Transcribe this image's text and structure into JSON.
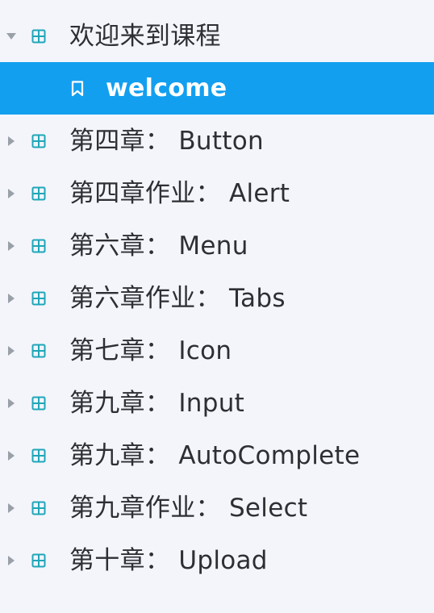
{
  "colors": {
    "background": "#f3f5fb",
    "selected_bg": "#139ff0",
    "icon": "#1fa6b8",
    "arrow": "#9aa0a8",
    "text": "#2d2f35"
  },
  "tree": {
    "root": {
      "label": "欢迎来到课程",
      "icon": "component-grid-icon",
      "expanded": true,
      "child": {
        "label": "welcome",
        "icon": "bookmark-icon",
        "selected": true
      }
    },
    "items": [
      {
        "label": "第四章： Button"
      },
      {
        "label": "第四章作业： Alert"
      },
      {
        "label": "第六章： Menu"
      },
      {
        "label": "第六章作业： Tabs"
      },
      {
        "label": "第七章： Icon"
      },
      {
        "label": "第九章： Input"
      },
      {
        "label": "第九章： AutoComplete"
      },
      {
        "label": "第九章作业： Select"
      },
      {
        "label": "第十章： Upload"
      }
    ]
  }
}
